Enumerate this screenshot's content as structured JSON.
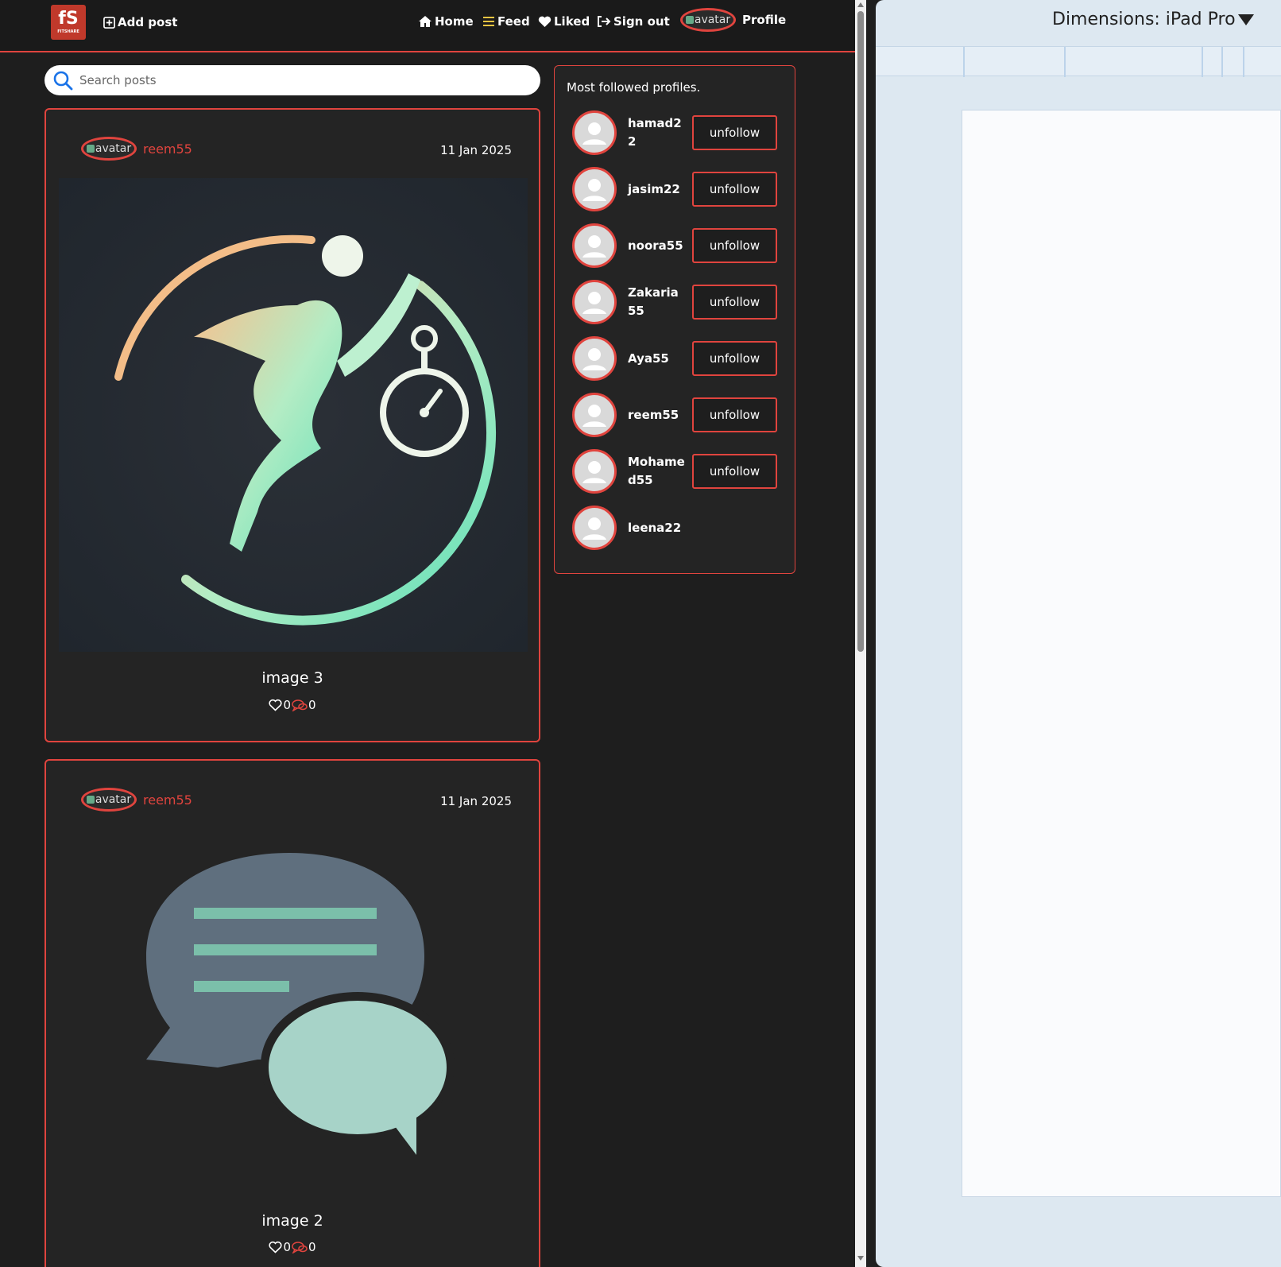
{
  "topbar": {
    "logo_text": "FITSHARE",
    "add_post": "Add post",
    "home": "Home",
    "feed": "Feed",
    "liked": "Liked",
    "sign_out": "Sign out",
    "avatar_alt": "avatar",
    "profile": "Profile"
  },
  "search": {
    "placeholder": "Search posts"
  },
  "posts": [
    {
      "avatar_alt": "avatar",
      "username": "reem55",
      "date": "11 Jan 2025",
      "title": "image 3",
      "likes": "0",
      "comments": "0"
    },
    {
      "avatar_alt": "avatar",
      "username": "reem55",
      "date": "11 Jan 2025",
      "title": "image 2",
      "likes": "0",
      "comments": "0"
    }
  ],
  "followers": {
    "title": "Most followed profiles.",
    "items": [
      {
        "name": "hamad22",
        "action": "unfollow"
      },
      {
        "name": "jasim22",
        "action": "unfollow"
      },
      {
        "name": "noora55",
        "action": "unfollow"
      },
      {
        "name": "Zakaria55",
        "action": "unfollow"
      },
      {
        "name": "Aya55",
        "action": "unfollow"
      },
      {
        "name": "reem55",
        "action": "unfollow"
      },
      {
        "name": "Mohamed55",
        "action": "unfollow"
      },
      {
        "name": "leena22",
        "action": ""
      }
    ]
  },
  "devtools": {
    "dimensions_label": "Dimensions: iPad Pro"
  },
  "colors": {
    "accent": "#e0443e",
    "background": "#1e1e1e",
    "card": "#242424"
  }
}
